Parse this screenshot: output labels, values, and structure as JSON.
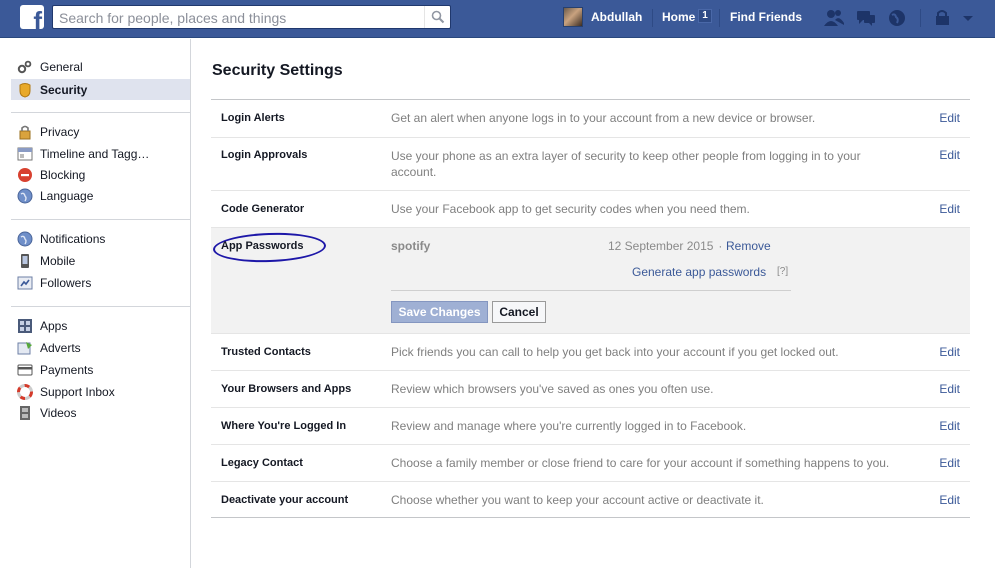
{
  "header": {
    "logo_letter": "f",
    "search_placeholder": "Search for people, places and things",
    "user_name": "Abdullah",
    "home_label": "Home",
    "home_count": "1",
    "find_friends_label": "Find Friends"
  },
  "sidebar": {
    "items": [
      {
        "label": "General",
        "icon": "gears-icon"
      },
      {
        "label": "Security",
        "icon": "shield-icon"
      },
      {
        "label": "Privacy",
        "icon": "lock-icon"
      },
      {
        "label": "Timeline and Tagg…",
        "icon": "timeline-icon"
      },
      {
        "label": "Blocking",
        "icon": "blocking-icon"
      },
      {
        "label": "Language",
        "icon": "globe-icon"
      },
      {
        "label": "Notifications",
        "icon": "globe-icon"
      },
      {
        "label": "Mobile",
        "icon": "mobile-icon"
      },
      {
        "label": "Followers",
        "icon": "followers-icon"
      },
      {
        "label": "Apps",
        "icon": "apps-icon"
      },
      {
        "label": "Adverts",
        "icon": "adverts-icon"
      },
      {
        "label": "Payments",
        "icon": "card-icon"
      },
      {
        "label": "Support Inbox",
        "icon": "lifebuoy-icon"
      },
      {
        "label": "Videos",
        "icon": "film-icon"
      }
    ]
  },
  "main": {
    "title": "Security Settings",
    "edit_label": "Edit",
    "rows": [
      {
        "label": "Login Alerts",
        "desc": "Get an alert when anyone logs in to your account from a new device or browser."
      },
      {
        "label": "Login Approvals",
        "desc": "Use your phone as an extra layer of security to keep other people from logging in to your account."
      },
      {
        "label": "Code Generator",
        "desc": "Use your Facebook app to get security codes when you need them."
      },
      {
        "label": "Trusted Contacts",
        "desc": "Pick friends you can call to help you get back into your account if you get locked out."
      },
      {
        "label": "Your Browsers and Apps",
        "desc": "Review which browsers you've saved as ones you often use."
      },
      {
        "label": "Where You're Logged In",
        "desc": "Review and manage where you're currently logged in to Facebook."
      },
      {
        "label": "Legacy Contact",
        "desc": "Choose a family member or close friend to care for your account if something happens to you."
      },
      {
        "label": "Deactivate your account",
        "desc": "Choose whether you want to keep your account active or deactivate it."
      }
    ],
    "app_passwords": {
      "label": "App Passwords",
      "app_name": "spotify",
      "date": "12 September 2015",
      "separator": " · ",
      "remove": "Remove",
      "generate": "Generate app passwords",
      "help": "[?]",
      "save": "Save Changes",
      "cancel": "Cancel"
    }
  }
}
